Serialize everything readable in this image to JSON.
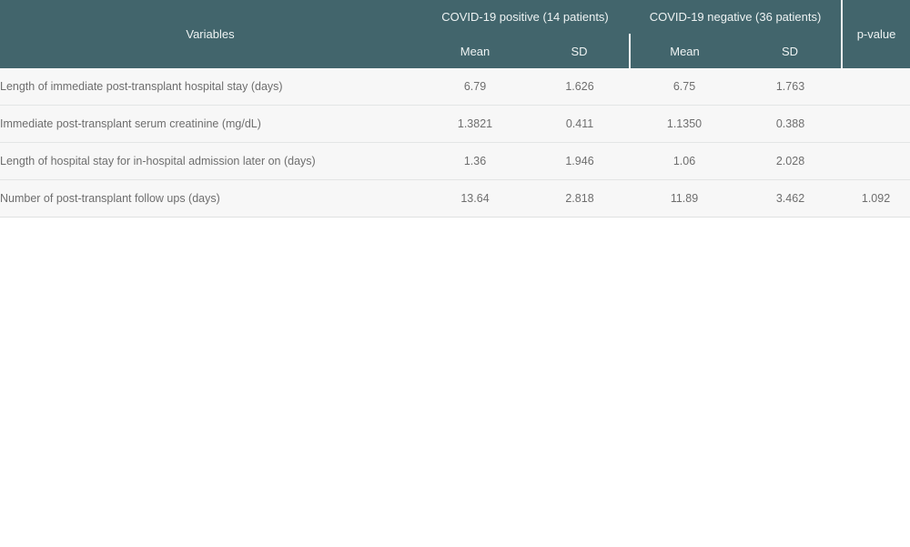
{
  "table": {
    "header": {
      "variables_label": "Variables",
      "groups": [
        {
          "label": "COVID-19 positive (14 patients)",
          "subcolumns": [
            "Mean",
            "SD"
          ]
        },
        {
          "label": "COVID-19 negative (36 patients)",
          "subcolumns": [
            "Mean",
            "SD"
          ]
        }
      ],
      "pvalue_label": "p-value"
    },
    "rows": [
      {
        "variable": "Length of immediate post-transplant hospital stay (days)",
        "positive_mean": "6.79",
        "positive_sd": "1.626",
        "negative_mean": "6.75",
        "negative_sd": "1.763",
        "p_value": ""
      },
      {
        "variable": "Immediate post-transplant serum creatinine (mg/dL)",
        "positive_mean": "1.3821",
        "positive_sd": "0.411",
        "negative_mean": "1.1350",
        "negative_sd": "0.388",
        "p_value": ""
      },
      {
        "variable": "Length of hospital stay for in-hospital admission later on (days)",
        "positive_mean": "1.36",
        "positive_sd": "1.946",
        "negative_mean": "1.06",
        "negative_sd": "2.028",
        "p_value": ""
      },
      {
        "variable": "Number of post-transplant follow ups (days)",
        "positive_mean": "13.64",
        "positive_sd": "2.818",
        "negative_mean": "11.89",
        "negative_sd": "3.462",
        "p_value": "1.092"
      }
    ]
  },
  "colors": {
    "header_background": "#42656c",
    "header_text": "#eef3f3",
    "row_background": "#f7f7f7",
    "body_text": "#6e6e6e",
    "row_divider": "#e3e5e5",
    "page_background": "#ffffff"
  }
}
